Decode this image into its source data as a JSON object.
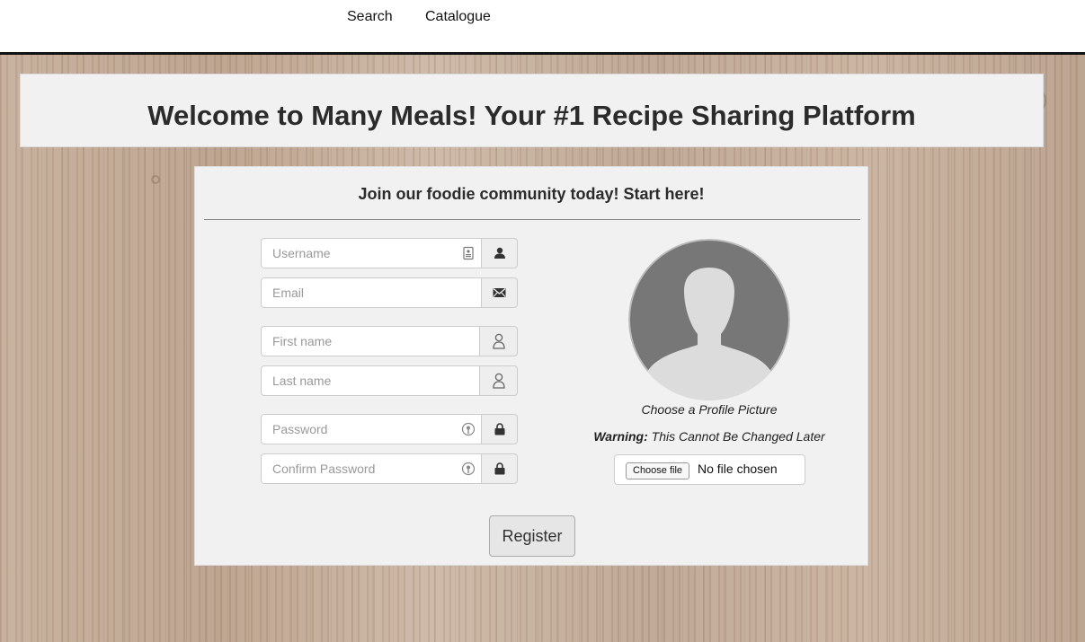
{
  "nav": {
    "search_label": "Search",
    "catalogue_label": "Catalogue"
  },
  "header": {
    "title": "Welcome to Many Meals! Your #1 Recipe Sharing Platform"
  },
  "form": {
    "subtitle": "Join our foodie community today! Start here!",
    "fields": {
      "username_placeholder": "Username",
      "email_placeholder": "Email",
      "first_name_placeholder": "First name",
      "last_name_placeholder": "Last name",
      "password_placeholder": "Password",
      "confirm_password_placeholder": "Confirm Password"
    },
    "icons": {
      "username": "user-icon",
      "email": "envelope-icon",
      "first_name": "person-outline-icon",
      "last_name": "person-outline-icon",
      "password": "lock-icon",
      "confirm_password": "lock-icon"
    },
    "profile": {
      "caption": "Choose a Profile Picture",
      "warning_label": "Warning:",
      "warning_text": " This Cannot Be Changed Later",
      "choose_file_label": "Choose file",
      "file_status": "No file chosen"
    },
    "register_label": "Register"
  },
  "colors": {
    "card_bg": "#f1f1f1",
    "addon_bg": "#eeeeee",
    "avatar_bg": "#777777",
    "avatar_silhouette": "#d9d9d9"
  }
}
